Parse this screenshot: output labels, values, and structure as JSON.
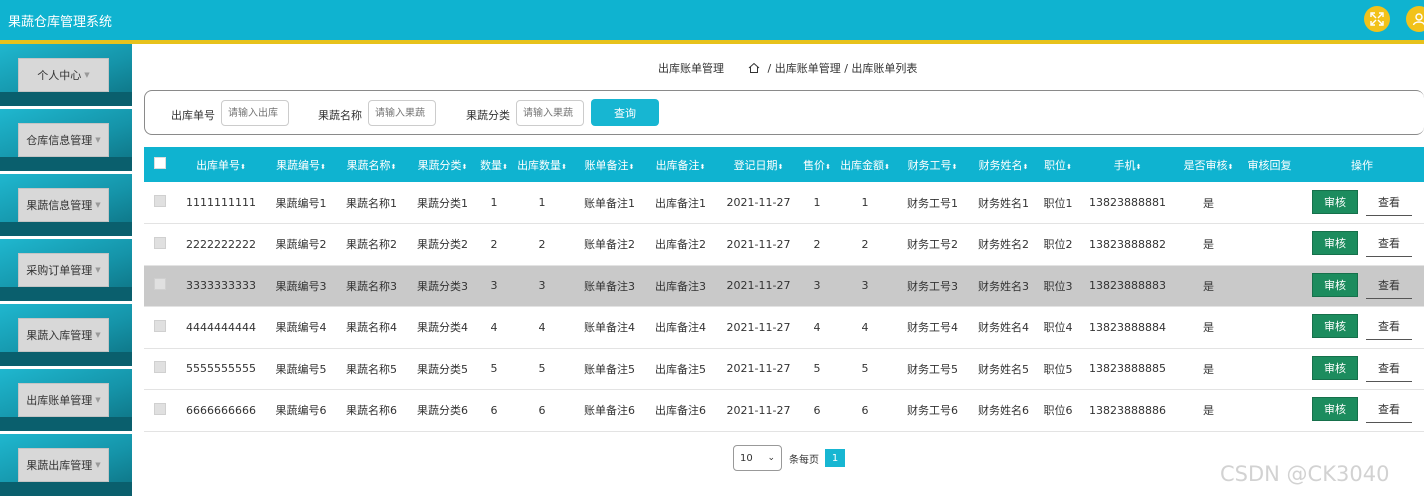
{
  "app": {
    "title": "果蔬仓库管理系统"
  },
  "topbar": {
    "icons": [
      "fullscreen-icon",
      "user-icon"
    ],
    "accent": "#0fb3d0",
    "stripe": "#e7c21c"
  },
  "sidebar": {
    "items": [
      {
        "label": "个人中心"
      },
      {
        "label": "仓库信息管理"
      },
      {
        "label": "果蔬信息管理"
      },
      {
        "label": "采购订单管理"
      },
      {
        "label": "果蔬入库管理"
      },
      {
        "label": "出库账单管理"
      },
      {
        "label": "果蔬出库管理"
      }
    ]
  },
  "breadcrumb": {
    "section": "出库账单管理",
    "path": [
      "出库账单管理",
      "出库账单列表"
    ]
  },
  "search": {
    "fields": [
      {
        "label": "出库单号",
        "placeholder": "请输入出库"
      },
      {
        "label": "果蔬名称",
        "placeholder": "请输入果蔬"
      },
      {
        "label": "果蔬分类",
        "placeholder": "请输入果蔬"
      }
    ],
    "button": "查询"
  },
  "table": {
    "columns": [
      "出库单号",
      "果蔬编号",
      "果蔬名称",
      "果蔬分类",
      "数量",
      "出库数量",
      "账单备注",
      "出库备注",
      "登记日期",
      "售价",
      "出库金额",
      "财务工号",
      "财务姓名",
      "职位",
      "手机",
      "是否审核",
      "审核回复",
      "操作"
    ],
    "sortable": [
      true,
      true,
      true,
      true,
      true,
      true,
      true,
      true,
      true,
      true,
      true,
      true,
      true,
      true,
      true,
      true,
      false,
      false
    ],
    "rows": [
      [
        "1111111111",
        "果蔬编号1",
        "果蔬名称1",
        "果蔬分类1",
        "1",
        "1",
        "账单备注1",
        "出库备注1",
        "2021-11-27",
        "1",
        "1",
        "财务工号1",
        "财务姓名1",
        "职位1",
        "13823888881",
        "是",
        ""
      ],
      [
        "2222222222",
        "果蔬编号2",
        "果蔬名称2",
        "果蔬分类2",
        "2",
        "2",
        "账单备注2",
        "出库备注2",
        "2021-11-27",
        "2",
        "2",
        "财务工号2",
        "财务姓名2",
        "职位2",
        "13823888882",
        "是",
        ""
      ],
      [
        "3333333333",
        "果蔬编号3",
        "果蔬名称3",
        "果蔬分类3",
        "3",
        "3",
        "账单备注3",
        "出库备注3",
        "2021-11-27",
        "3",
        "3",
        "财务工号3",
        "财务姓名3",
        "职位3",
        "13823888883",
        "是",
        ""
      ],
      [
        "4444444444",
        "果蔬编号4",
        "果蔬名称4",
        "果蔬分类4",
        "4",
        "4",
        "账单备注4",
        "出库备注4",
        "2021-11-27",
        "4",
        "4",
        "财务工号4",
        "财务姓名4",
        "职位4",
        "13823888884",
        "是",
        ""
      ],
      [
        "5555555555",
        "果蔬编号5",
        "果蔬名称5",
        "果蔬分类5",
        "5",
        "5",
        "账单备注5",
        "出库备注5",
        "2021-11-27",
        "5",
        "5",
        "财务工号5",
        "财务姓名5",
        "职位5",
        "13823888885",
        "是",
        ""
      ],
      [
        "6666666666",
        "果蔬编号6",
        "果蔬名称6",
        "果蔬分类6",
        "6",
        "6",
        "账单备注6",
        "出库备注6",
        "2021-11-27",
        "6",
        "6",
        "财务工号6",
        "财务姓名6",
        "职位6",
        "13823888886",
        "是",
        ""
      ]
    ],
    "selected_row": 2,
    "actions": {
      "audit": "审核",
      "view": "查看"
    }
  },
  "pagination": {
    "page_size": "10",
    "per_page_label": "条每页",
    "current_page": "1"
  },
  "watermark": "CSDN @CK3040"
}
